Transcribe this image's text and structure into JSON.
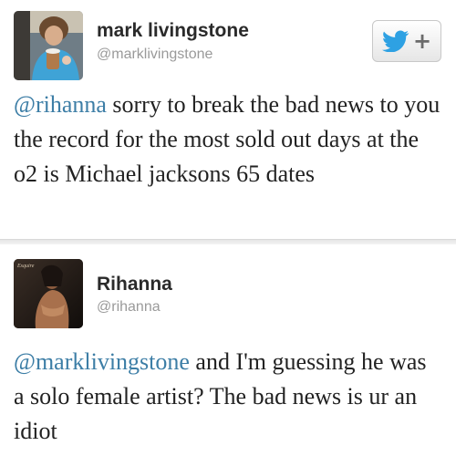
{
  "tweets": [
    {
      "name": "mark livingstone",
      "handle": "@marklivingstone",
      "follow_label": "+",
      "mention": "@rihanna",
      "text": " sorry to break the bad news to you the record for the most sold out days at the o2 is Michael jacksons 65 dates"
    },
    {
      "name": "Rihanna",
      "handle": "@rihanna",
      "avatar_caption": "Esquire",
      "mention": "@marklivingstone",
      "text": " and I'm guessing he was a solo female artist? The bad news is ur an idiot"
    }
  ],
  "colors": {
    "mention": "#3d7ea6",
    "twitter_bird": "#2ea1e3",
    "handle": "#9a9a9a"
  },
  "icons": {
    "follow": "twitter-bird-icon"
  }
}
